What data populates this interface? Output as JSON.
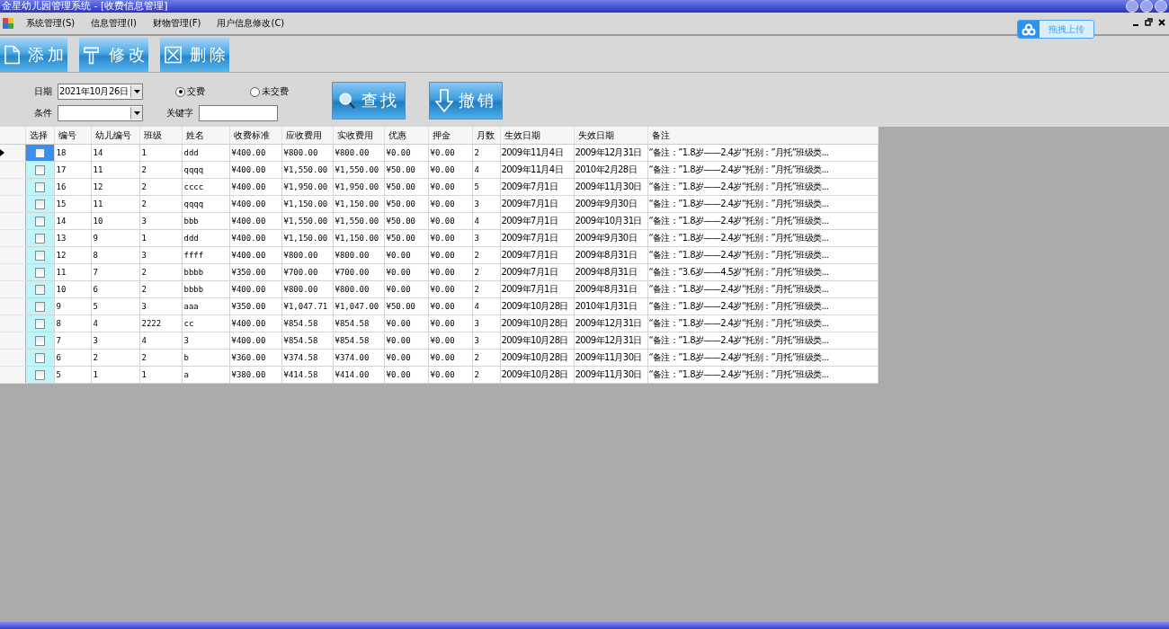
{
  "window": {
    "title": "金星幼儿园管理系统 - [收费信息管理]"
  },
  "menu": [
    "系统管理(S)",
    "信息管理(I)",
    "财物管理(F)",
    "用户信息修改(C)"
  ],
  "upload_badge": {
    "label": "拖拽上传"
  },
  "toolbar": [
    {
      "kind": "add",
      "label": "添加"
    },
    {
      "kind": "edit",
      "label": "修改"
    },
    {
      "kind": "delete",
      "label": "删除"
    }
  ],
  "filters": {
    "date_label": "日期",
    "date_value": "2021年10月26日",
    "condition_label": "条件",
    "keyword_label": "关键字",
    "radios": [
      {
        "label": "交费",
        "selected": true
      },
      {
        "label": "未交费",
        "selected": false
      }
    ]
  },
  "actions": [
    {
      "kind": "search",
      "label": "查找"
    },
    {
      "kind": "undo",
      "label": "撤销"
    }
  ],
  "table": {
    "select_header": "选择",
    "columns": [
      "编号",
      "幼儿编号",
      "班级",
      "姓名",
      "收费标准",
      "应收费用",
      "实收费用",
      "优惠",
      "押金",
      "月数",
      "生效日期",
      "失效日期",
      "备注"
    ],
    "rows": [
      {
        "selected": true,
        "checked": false,
        "cells": [
          "18",
          "14",
          "1",
          "ddd",
          "¥400.00",
          "¥800.00",
          "¥800.00",
          "¥0.00",
          "¥0.00",
          "2",
          "2009年11月4日",
          "2009年12月31日",
          "“备注：”1.8岁——2.4岁“托别：”月托“班级类..."
        ]
      },
      {
        "selected": false,
        "checked": false,
        "cells": [
          "17",
          "11",
          "2",
          "qqqq",
          "¥400.00",
          "¥1,550.00",
          "¥1,550.00",
          "¥50.00",
          "¥0.00",
          "4",
          "2009年11月4日",
          "2010年2月28日",
          "“备注：”1.8岁——2.4岁“托别：”月托“班级类..."
        ]
      },
      {
        "selected": false,
        "checked": false,
        "cells": [
          "16",
          "12",
          "2",
          "cccc",
          "¥400.00",
          "¥1,950.00",
          "¥1,950.00",
          "¥50.00",
          "¥0.00",
          "5",
          "2009年7月1日",
          "2009年11月30日",
          "“备注：”1.8岁——2.4岁“托别：”月托“班级类..."
        ]
      },
      {
        "selected": false,
        "checked": false,
        "cells": [
          "15",
          "11",
          "2",
          "qqqq",
          "¥400.00",
          "¥1,150.00",
          "¥1,150.00",
          "¥50.00",
          "¥0.00",
          "3",
          "2009年7月1日",
          "2009年9月30日",
          "“备注：”1.8岁——2.4岁“托别：”月托“班级类..."
        ]
      },
      {
        "selected": false,
        "checked": false,
        "cells": [
          "14",
          "10",
          "3",
          "bbb",
          "¥400.00",
          "¥1,550.00",
          "¥1,550.00",
          "¥50.00",
          "¥0.00",
          "4",
          "2009年7月1日",
          "2009年10月31日",
          "“备注：”1.8岁——2.4岁“托别：”月托“班级类..."
        ]
      },
      {
        "selected": false,
        "checked": false,
        "cells": [
          "13",
          "9",
          "1",
          "ddd",
          "¥400.00",
          "¥1,150.00",
          "¥1,150.00",
          "¥50.00",
          "¥0.00",
          "3",
          "2009年7月1日",
          "2009年9月30日",
          "“备注：”1.8岁——2.4岁“托别：”月托“班级类..."
        ]
      },
      {
        "selected": false,
        "checked": false,
        "cells": [
          "12",
          "8",
          "3",
          "ffff",
          "¥400.00",
          "¥800.00",
          "¥800.00",
          "¥0.00",
          "¥0.00",
          "2",
          "2009年7月1日",
          "2009年8月31日",
          "“备注：”1.8岁——2.4岁“托别：”月托“班级类..."
        ]
      },
      {
        "selected": false,
        "checked": false,
        "cells": [
          "11",
          "7",
          "2",
          "bbbb",
          "¥350.00",
          "¥700.00",
          "¥700.00",
          "¥0.00",
          "¥0.00",
          "2",
          "2009年7月1日",
          "2009年8月31日",
          "“备注：”3.6岁——4.5岁“托别：”月托“班级类..."
        ]
      },
      {
        "selected": false,
        "checked": false,
        "cells": [
          "10",
          "6",
          "2",
          "bbbb",
          "¥400.00",
          "¥800.00",
          "¥800.00",
          "¥0.00",
          "¥0.00",
          "2",
          "2009年7月1日",
          "2009年8月31日",
          "“备注：”1.8岁——2.4岁“托别：”月托“班级类..."
        ]
      },
      {
        "selected": false,
        "checked": false,
        "cells": [
          "9",
          "5",
          "3",
          "aaa",
          "¥350.00",
          "¥1,047.71",
          "¥1,047.00",
          "¥50.00",
          "¥0.00",
          "4",
          "2009年10月28日",
          "2010年1月31日",
          "“备注：”1.8岁——2.4岁“托别：”月托“班级类..."
        ]
      },
      {
        "selected": false,
        "checked": false,
        "cells": [
          "8",
          "4",
          "2222",
          "cc",
          "¥400.00",
          "¥854.58",
          "¥854.58",
          "¥0.00",
          "¥0.00",
          "3",
          "2009年10月28日",
          "2009年12月31日",
          "“备注：”1.8岁——2.4岁“托别：”月托“班级类..."
        ]
      },
      {
        "selected": false,
        "checked": false,
        "cells": [
          "7",
          "3",
          "4",
          "3",
          "¥400.00",
          "¥854.58",
          "¥854.58",
          "¥0.00",
          "¥0.00",
          "3",
          "2009年10月28日",
          "2009年12月31日",
          "“备注：”1.8岁——2.4岁“托别：”月托“班级类..."
        ]
      },
      {
        "selected": false,
        "checked": false,
        "cells": [
          "6",
          "2",
          "2",
          "b",
          "¥360.00",
          "¥374.58",
          "¥374.00",
          "¥0.00",
          "¥0.00",
          "2",
          "2009年10月28日",
          "2009年11月30日",
          "“备注：”1.8岁——2.4岁“托别：”月托“班级类..."
        ]
      },
      {
        "selected": false,
        "checked": false,
        "cells": [
          "5",
          "1",
          "1",
          "a",
          "¥380.00",
          "¥414.58",
          "¥414.00",
          "¥0.00",
          "¥0.00",
          "2",
          "2009年10月28日",
          "2009年11月30日",
          "“备注：”1.8岁——2.4岁“托别：”月托“班级类..."
        ]
      }
    ]
  }
}
